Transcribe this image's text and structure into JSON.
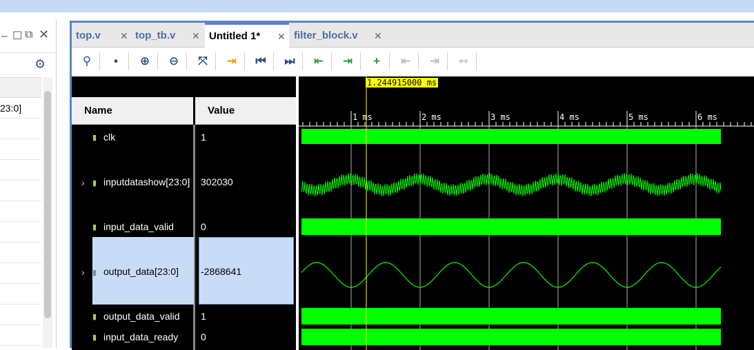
{
  "left_panel": {
    "row_fragment": "23:0]"
  },
  "tabs": [
    {
      "label": "top.v",
      "active": false
    },
    {
      "label": "top_tb.v",
      "active": false
    },
    {
      "label": "Untitled 1*",
      "active": true
    },
    {
      "label": "filter_block.v",
      "active": false
    }
  ],
  "toolbar_icons": [
    "search-icon",
    "save-icon",
    "zoom-in-icon",
    "zoom-out-icon",
    "zoom-fit-icon",
    "go-to-cursor-icon",
    "go-to-start-icon",
    "go-to-end-icon",
    "previous-transition-icon",
    "next-transition-icon",
    "add-marker-icon",
    "previous-marker-icon",
    "next-marker-icon",
    "swap-cursors-icon"
  ],
  "wave": {
    "cursor_time": "1.244915000 ms",
    "columns": {
      "name": "Name",
      "value": "Value"
    },
    "ticks": [
      "1 ms",
      "2 ms",
      "3 ms",
      "4 ms",
      "5 ms",
      "6 ms"
    ],
    "signals": [
      {
        "name": "clk",
        "value": "1",
        "expandable": false
      },
      {
        "name": "inputdatashow[23:0]",
        "value": "302030",
        "expandable": true
      },
      {
        "name": "input_data_valid",
        "value": "0",
        "expandable": false
      },
      {
        "name": "output_data[23:0]",
        "value": "-2868641",
        "expandable": true
      },
      {
        "name": "output_data_valid",
        "value": "1",
        "expandable": false
      },
      {
        "name": "input_data_ready",
        "value": "0",
        "expandable": false
      }
    ]
  },
  "colors": {
    "wave": "#00ff00",
    "cursor": "#ffff00",
    "accent": "#5b85c7"
  }
}
